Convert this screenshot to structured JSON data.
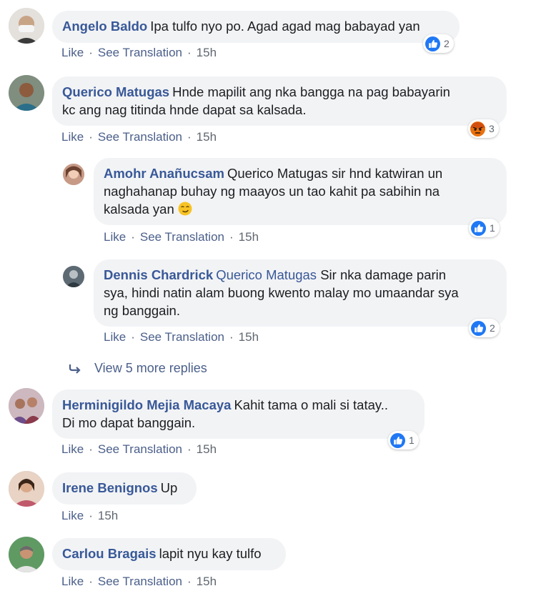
{
  "comments": [
    {
      "author": "Angelo Baldo",
      "text": "Ipa tulfo nyo po. Agad agad mag babayad yan",
      "like": "Like",
      "translate": "See Translation",
      "time": "15h",
      "reaction_count": "2",
      "reaction_icon": "like-icon"
    },
    {
      "author": "Querico Matugas",
      "text_lines": [
        "Hnde mapilit ang nka bangga na pag babayarin",
        "kc ang nag titinda hnde dapat sa kalsada."
      ],
      "like": "Like",
      "translate": "See Translation",
      "time": "15h",
      "reaction_count": "3",
      "reaction_icon": "angry-icon"
    },
    {
      "author": "Herminigildo Mejia Macaya",
      "text_lines": [
        "Kahit tama o mali si tatay..",
        "Di mo dapat banggain."
      ],
      "like": "Like",
      "translate": "See Translation",
      "time": "15h",
      "reaction_count": "1",
      "reaction_icon": "like-icon"
    },
    {
      "author": "Irene Benignos",
      "text": "Up",
      "like": "Like",
      "time": "15h"
    },
    {
      "author": "Carlou Bragais",
      "text": "lapit nyu kay tulfo",
      "like": "Like",
      "translate": "See Translation",
      "time": "15h"
    }
  ],
  "replies": [
    {
      "author": "Amohr Anañucsam",
      "text_lines": [
        "Querico Matugas sir hnd katwiran un",
        "naghahanap buhay ng maayos un tao kahit pa sabihin na",
        "kalsada yan"
      ],
      "emoji": "smirk-face",
      "like": "Like",
      "translate": "See Translation",
      "time": "15h",
      "reaction_count": "1",
      "reaction_icon": "like-icon"
    },
    {
      "author": "Dennis Chardrick",
      "mention": "Querico Matugas",
      "text_lines": [
        " Sir nka damage parin",
        "sya, hindi natin alam buong kwento malay mo umaandar sya",
        "ng banggain."
      ],
      "like": "Like",
      "translate": "See Translation",
      "time": "15h",
      "reaction_count": "2",
      "reaction_icon": "like-icon"
    }
  ],
  "view_more": "View 5 more replies",
  "colors": {
    "author": "#385898",
    "bubble": "#f2f3f5",
    "like_blue": "#2078f4",
    "angry_orange": "#e9710f"
  }
}
